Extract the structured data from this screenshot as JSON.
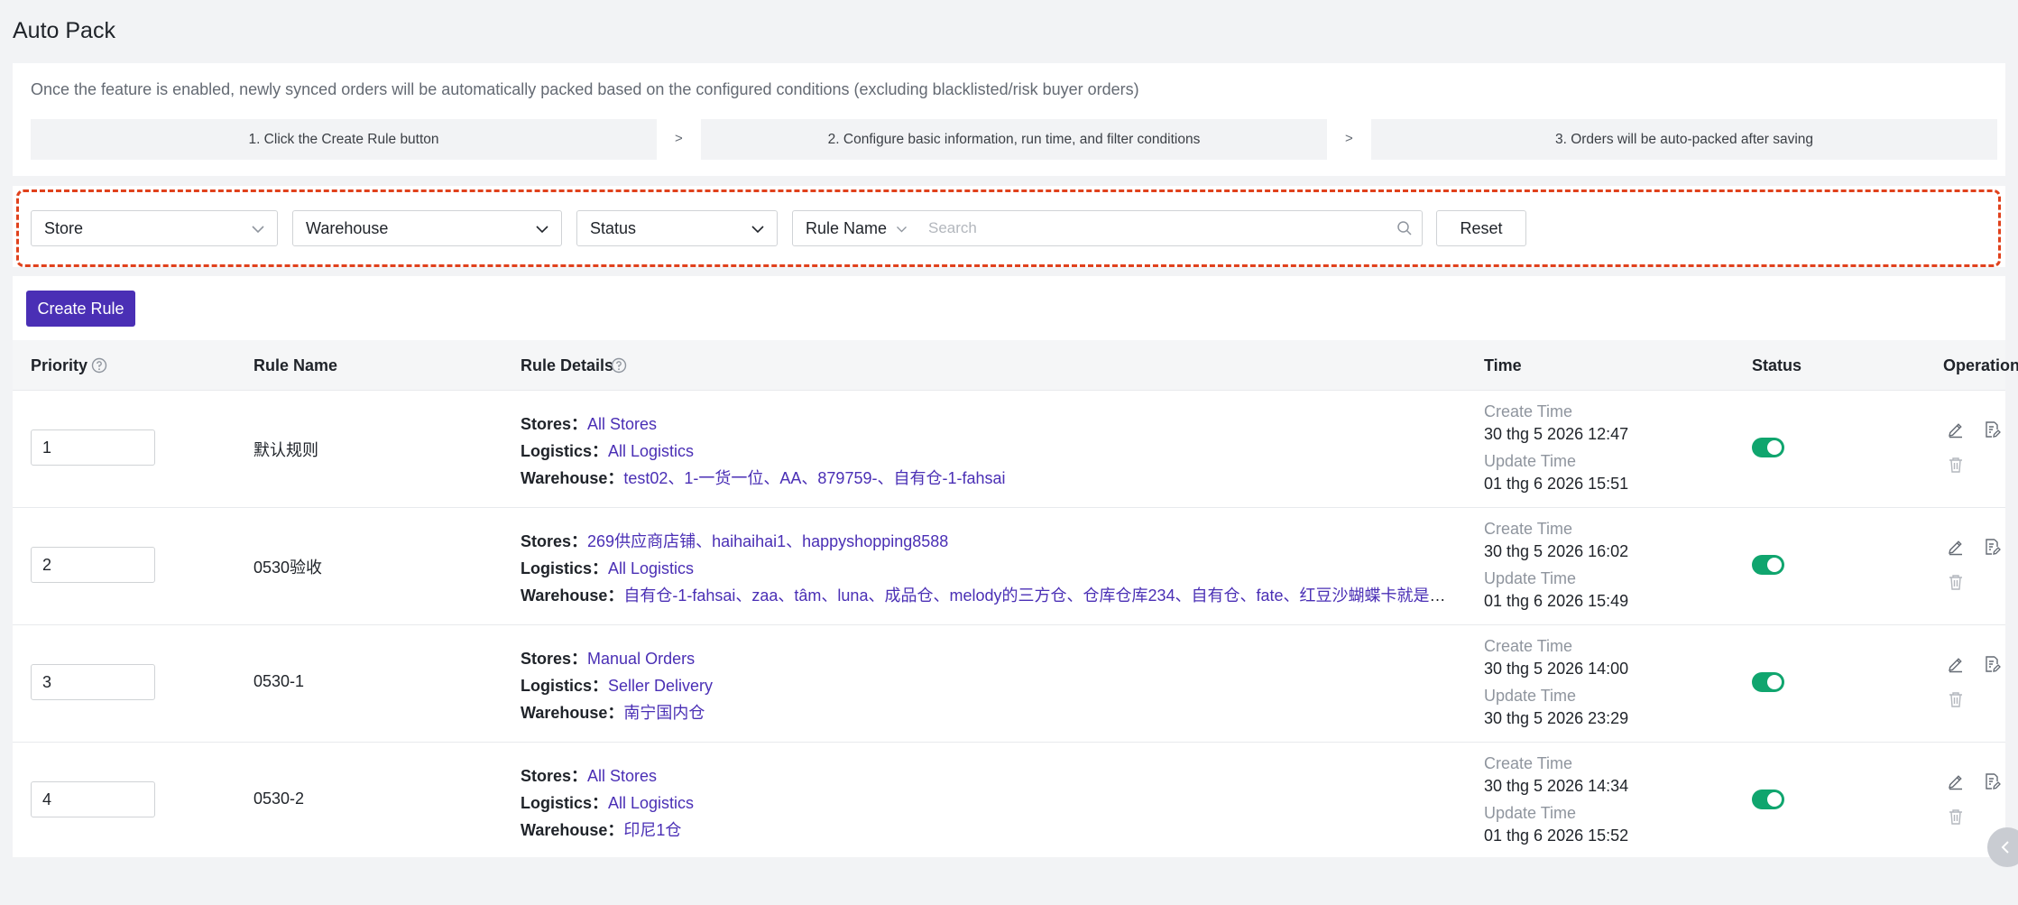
{
  "page": {
    "title": "Auto Pack"
  },
  "info": {
    "description": "Once the feature is enabled, newly synced orders will be automatically packed based on the configured conditions (excluding blacklisted/risk buyer orders)",
    "steps": [
      "1. Click the Create Rule button",
      "2. Configure basic information, run time, and filter conditions",
      "3. Orders will be auto-packed after saving"
    ],
    "arrow": ">"
  },
  "filters": {
    "store": "Store",
    "warehouse": "Warehouse",
    "status": "Status",
    "search_field": "Rule Name",
    "search_placeholder": "Search",
    "reset_label": "Reset"
  },
  "toolbar": {
    "create_label": "Create Rule"
  },
  "table": {
    "headers": {
      "priority": "Priority",
      "rule_name": "Rule Name",
      "rule_details": "Rule Details",
      "time": "Time",
      "status": "Status",
      "operation": "Operation"
    },
    "labels": {
      "stores": "Stores：",
      "logistics": "Logistics：",
      "warehouse": "Warehouse：",
      "create_time": "Create Time",
      "update_time": "Update Time"
    },
    "rows": [
      {
        "priority": "1",
        "name": "默认规则",
        "stores": "All Stores",
        "logistics": "All Logistics",
        "warehouse": "test02、1-一货一位、AA、879759-、自有仓-1-fahsai",
        "create_time": "30 thg 5 2026 12:47",
        "update_time": "01 thg 6 2026 15:51",
        "enabled": true
      },
      {
        "priority": "2",
        "name": "0530验收",
        "stores": "269供应商店铺、haihaihai1、happyshopping8588",
        "logistics": "All Logistics",
        "warehouse": "自有仓-1-fahsai、zaa、tâm、luna、成品仓、melody的三方仓、仓库仓库234、自有仓、fate、红豆沙蝴蝶卡就是、#...",
        "create_time": "30 thg 5 2026 16:02",
        "update_time": "01 thg 6 2026 15:49",
        "enabled": true
      },
      {
        "priority": "3",
        "name": "0530-1",
        "stores": "Manual Orders",
        "logistics": "Seller Delivery",
        "warehouse": "南宁国内仓",
        "create_time": "30 thg 5 2026 14:00",
        "update_time": "30 thg 5 2026 23:29",
        "enabled": true
      },
      {
        "priority": "4",
        "name": "0530-2",
        "stores": "All Stores",
        "logistics": "All Logistics",
        "warehouse": "印尼1仓",
        "create_time": "30 thg 5 2026 14:34",
        "update_time": "01 thg 6 2026 15:52",
        "enabled": true
      }
    ]
  },
  "colors": {
    "accent": "#4a2fb5",
    "toggle_on": "#10a56e",
    "highlight_dash": "#e0411c"
  }
}
